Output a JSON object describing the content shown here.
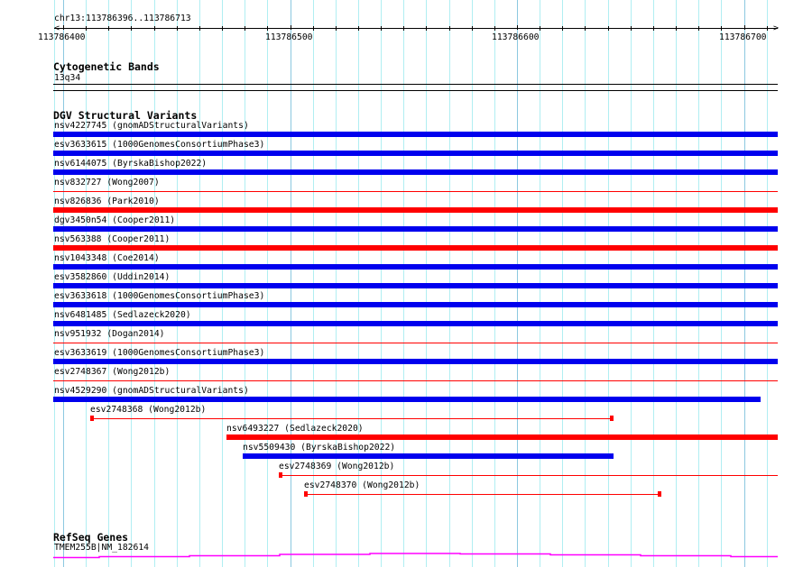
{
  "ruler": {
    "region": "chr13:113786396..113786713",
    "ticks": [
      "113786400",
      "113786500",
      "113786600",
      "113786700"
    ]
  },
  "tracks": {
    "cytoband": {
      "title": "Cytogenetic Bands",
      "band": "13q34"
    },
    "dgv": {
      "title": "DGV Structural Variants",
      "variants": [
        {
          "label": "nsv4227745 (gnomADStructuralVariants)",
          "color": "#0000ee"
        },
        {
          "label": "esv3633615 (1000GenomesConsortiumPhase3)",
          "color": "#0000ee"
        },
        {
          "label": "nsv6144075 (ByrskaBishop2022)",
          "color": "#0000ee"
        },
        {
          "label": "nsv832727 (Wong2007)",
          "color": "#ff0000"
        },
        {
          "label": "nsv826836 (Park2010)",
          "color": "#ff0000"
        },
        {
          "label": "dgv3450n54 (Cooper2011)",
          "color": "#0000ee"
        },
        {
          "label": "nsv563388 (Cooper2011)",
          "color": "#ff0000"
        },
        {
          "label": "nsv1043348 (Coe2014)",
          "color": "#0000ee"
        },
        {
          "label": "esv3582860 (Uddin2014)",
          "color": "#0000ee"
        },
        {
          "label": "esv3633618 (1000GenomesConsortiumPhase3)",
          "color": "#0000ee"
        },
        {
          "label": "nsv6481485 (Sedlazeck2020)",
          "color": "#0000ee"
        },
        {
          "label": "nsv951932 (Dogan2014)",
          "color": "#ff0000"
        },
        {
          "label": "esv3633619 (1000GenomesConsortiumPhase3)",
          "color": "#0000ee"
        },
        {
          "label": "esv2748367 (Wong2012b)",
          "color": "#ff0000"
        },
        {
          "label": "nsv4529290 (gnomADStructuralVariants)",
          "color": "#0000ee"
        },
        {
          "label": "esv2748368 (Wong2012b)",
          "color": "#ff0000"
        },
        {
          "label": "nsv6493227 (Sedlazeck2020)",
          "color": "#ff0000"
        },
        {
          "label": "nsv5509430 (ByrskaBishop2022)",
          "color": "#0000ee"
        },
        {
          "label": "esv2748369 (Wong2012b)",
          "color": "#ff0000"
        },
        {
          "label": "esv2748370 (Wong2012b)",
          "color": "#ff0000"
        }
      ]
    },
    "refseq": {
      "title": "RefSeq Genes",
      "gene": "TMEM255B|NM_182614",
      "color": "#ff00ff"
    }
  }
}
